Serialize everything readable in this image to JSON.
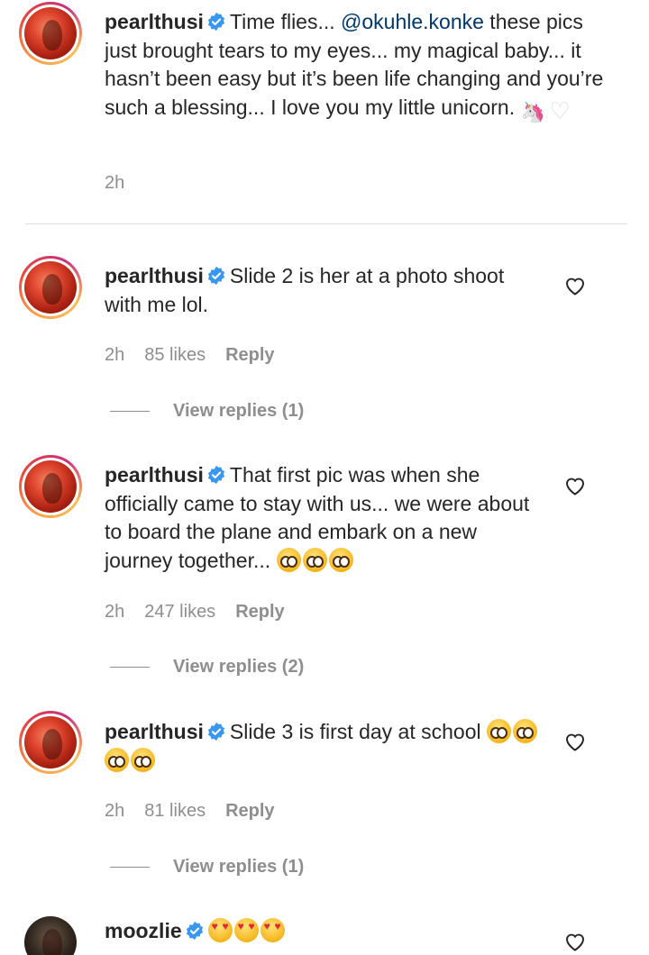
{
  "caption": {
    "username": "pearlthusi",
    "text_before": "Time flies... ",
    "mention": "@okuhle.konke",
    "text_after": " these pics just brought tears to my eyes... my magical baby... it hasn’t been easy but it’s been life changing and you’re such a blessing... I love you my little unicorn. ",
    "time": "2h"
  },
  "comments": [
    {
      "username": "pearlthusi",
      "text": "Slide 2 is her at a photo shoot with me lol.",
      "time": "2h",
      "likes": "85 likes",
      "reply_label": "Reply",
      "view_replies": "View replies (1)"
    },
    {
      "username": "pearlthusi",
      "text": "That first pic was when she officially came to stay with us... we were about to board the plane and embark on a new journey together... ",
      "time": "2h",
      "likes": "247 likes",
      "reply_label": "Reply",
      "view_replies": "View replies (2)"
    },
    {
      "username": "pearlthusi",
      "text": "Slide 3 is first day at school ",
      "time": "2h",
      "likes": "81 likes",
      "reply_label": "Reply",
      "view_replies": "View replies (1)"
    },
    {
      "username": "moozlie",
      "text": ""
    }
  ],
  "icons": {
    "verified": "verified-badge-icon",
    "like": "heart-outline-icon",
    "unicorn": "unicorn-emoji-icon",
    "white_heart": "white-heart-emoji-icon",
    "pleading": "pleading-face-emoji-icon",
    "heart_eyes": "heart-eyes-emoji-icon"
  },
  "colors": {
    "text": "#262626",
    "secondary": "#8e8e8e",
    "mention": "#00376b",
    "verified_blue": "#3897f0"
  }
}
